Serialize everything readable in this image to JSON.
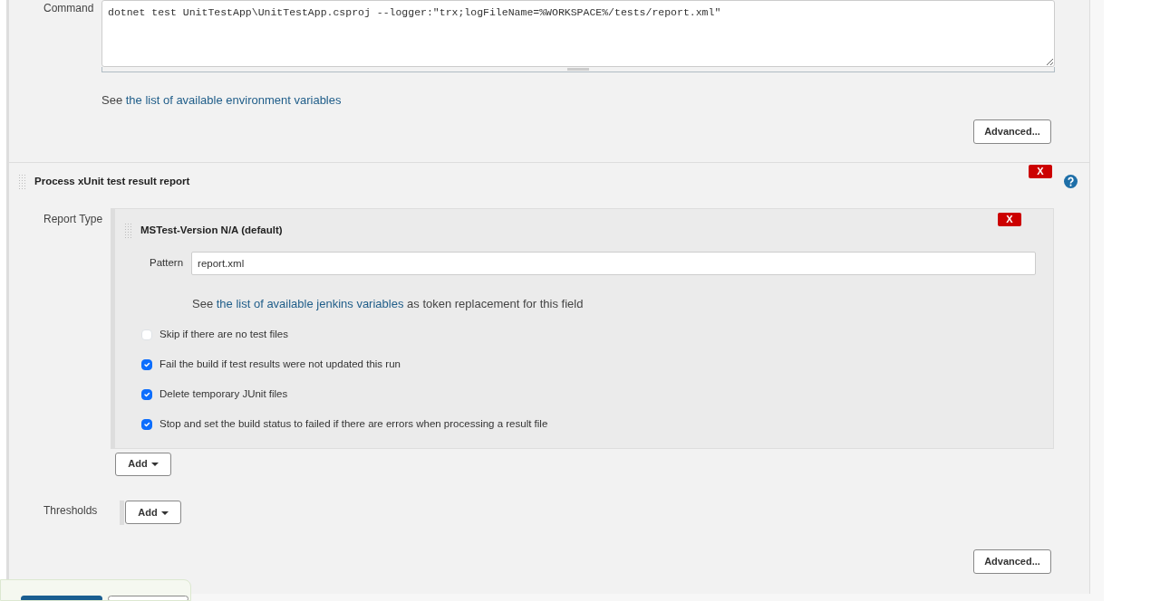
{
  "build_step": {
    "label": "Command",
    "value": "dotnet test UnitTestApp\\UnitTestApp.csproj --logger:\"trx;logFileName=%WORKSPACE%/tests/report.xml\"",
    "hint_prefix": "See",
    "hint_link": "the list of available environment variables",
    "advanced": "Advanced..."
  },
  "post_build": {
    "title": "Process xUnit test result report",
    "delete": "X",
    "report_type": {
      "label": "Report Type",
      "tool": {
        "title": "MSTest-Version N/A (default)",
        "delete": "X",
        "pattern_label": "Pattern",
        "pattern": "report.xml",
        "hint_prefix": "See",
        "hint_link": "the list of available jenkins variables",
        "hint_suffix": "as token replacement for this field",
        "options": [
          {
            "label": "Skip if there are no test files",
            "checked": false
          },
          {
            "label": "Fail the build if test results were not updated this run",
            "checked": true
          },
          {
            "label": "Delete temporary JUnit files",
            "checked": true
          },
          {
            "label": "Stop and set the build status to failed if there are errors when processing a result file",
            "checked": true
          }
        ]
      },
      "add": "Add"
    },
    "thresholds": {
      "label": "Thresholds",
      "add": "Add"
    },
    "advanced": "Advanced..."
  }
}
